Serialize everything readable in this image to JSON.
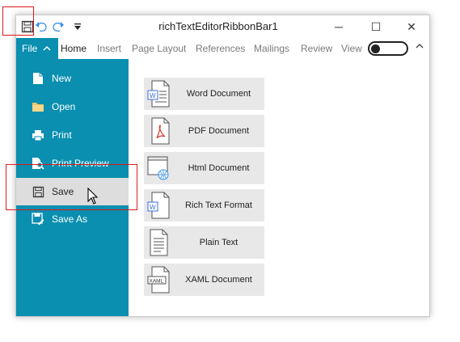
{
  "window": {
    "title": "richTextEditorRibbonBar1"
  },
  "qat": {
    "save_icon": "save-icon",
    "undo_icon": "undo-icon",
    "redo_icon": "redo-icon",
    "customize_icon": "dropdown-arrow-icon"
  },
  "controls": {
    "minimize": "─",
    "maximize": "☐",
    "close": "✕"
  },
  "ribbon": {
    "file_label": "File",
    "tabs": [
      "Home",
      "Insert",
      "Page Layout",
      "References",
      "Mailings",
      "Review",
      "View"
    ],
    "active_tab": "Home",
    "toggle_state": "off"
  },
  "backstage": {
    "menu": [
      {
        "label": "New",
        "icon": "new-document-icon"
      },
      {
        "label": "Open",
        "icon": "folder-icon"
      },
      {
        "label": "Print",
        "icon": "printer-icon"
      },
      {
        "label": "Print Preview",
        "icon": "print-preview-icon"
      },
      {
        "label": "Save",
        "icon": "save-icon",
        "selected": true
      },
      {
        "label": "Save As",
        "icon": "save-as-icon"
      }
    ],
    "formats": [
      {
        "label": "Word Document",
        "icon": "word-document-icon"
      },
      {
        "label": "PDF Document",
        "icon": "pdf-document-icon"
      },
      {
        "label": "Html Document",
        "icon": "html-document-icon"
      },
      {
        "label": "Rich Text Format",
        "icon": "rtf-document-icon"
      },
      {
        "label": "Plain Text",
        "icon": "plain-text-icon"
      },
      {
        "label": "XAML Document",
        "icon": "xaml-document-icon"
      }
    ]
  },
  "colors": {
    "accent": "#0a8fb0",
    "selected_bg": "#dddddd",
    "highlight": "#e0191a",
    "tile_bg": "#e8e8e8"
  }
}
